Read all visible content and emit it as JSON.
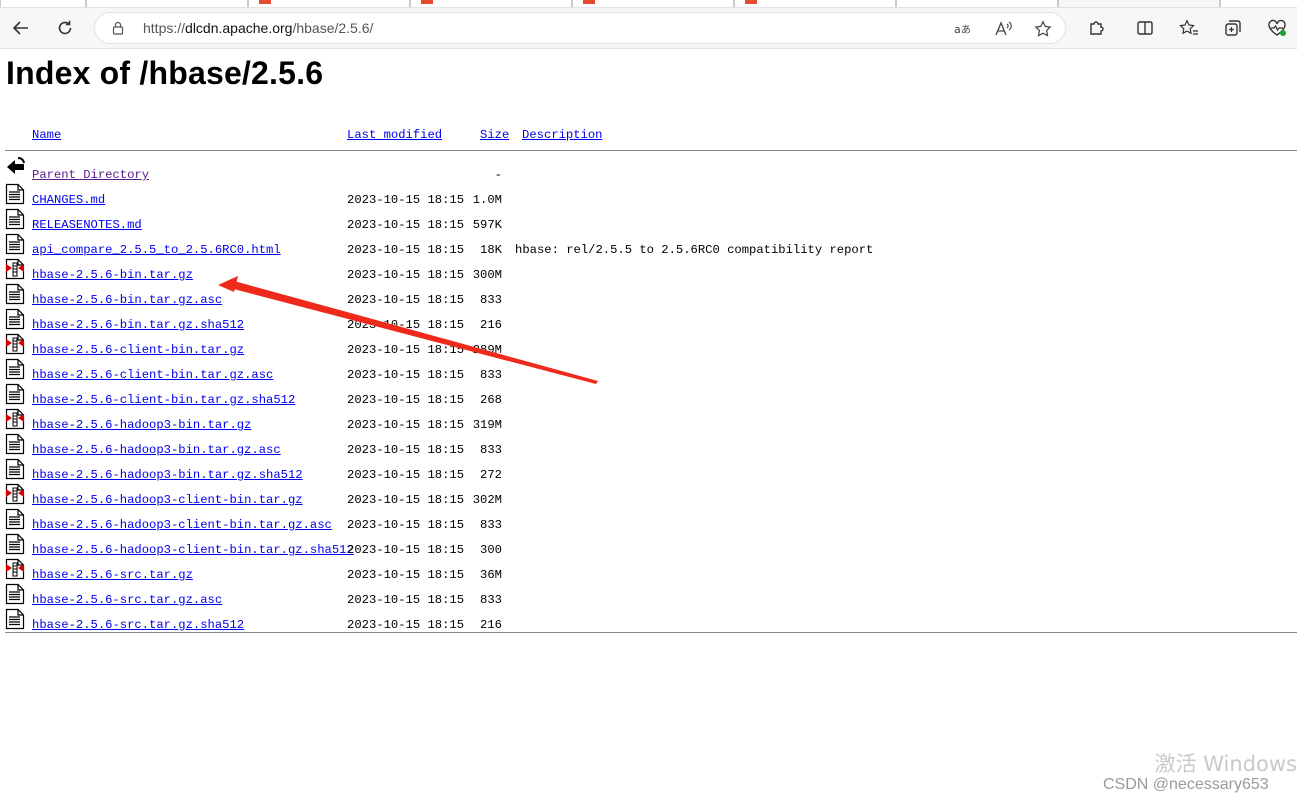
{
  "browser": {
    "url_prefix": "https://",
    "url_host": "dlcdn.apache.org",
    "url_path": "/hbase/2.5.6/"
  },
  "page": {
    "title": "Index of /hbase/2.5.6"
  },
  "listing": {
    "headers": {
      "name": "Name",
      "modified": "Last modified",
      "size": "Size",
      "description": "Description"
    },
    "rows": [
      {
        "name": "Parent Directory",
        "modified": "",
        "size": "-",
        "description": "",
        "icon": "back-icon",
        "visited": true
      },
      {
        "name": "CHANGES.md",
        "modified": "2023-10-15 18:15",
        "size": "1.0M",
        "description": "",
        "icon": "text-file-icon"
      },
      {
        "name": "RELEASENOTES.md",
        "modified": "2023-10-15 18:15",
        "size": "597K",
        "description": "",
        "icon": "text-file-icon"
      },
      {
        "name": "api_compare_2.5.5_to_2.5.6RC0.html",
        "modified": "2023-10-15 18:15",
        "size": "18K",
        "description": "hbase: rel/2.5.5 to 2.5.6RC0 compatibility report",
        "icon": "text-file-icon"
      },
      {
        "name": "hbase-2.5.6-bin.tar.gz",
        "modified": "2023-10-15 18:15",
        "size": "300M",
        "description": "",
        "icon": "archive-icon"
      },
      {
        "name": "hbase-2.5.6-bin.tar.gz.asc",
        "modified": "2023-10-15 18:15",
        "size": "833",
        "description": "",
        "icon": "text-file-icon"
      },
      {
        "name": "hbase-2.5.6-bin.tar.gz.sha512",
        "modified": "2023-10-15 18:15",
        "size": "216",
        "description": "",
        "icon": "text-file-icon"
      },
      {
        "name": "hbase-2.5.6-client-bin.tar.gz",
        "modified": "2023-10-15 18:15",
        "size": "289M",
        "description": "",
        "icon": "archive-icon"
      },
      {
        "name": "hbase-2.5.6-client-bin.tar.gz.asc",
        "modified": "2023-10-15 18:15",
        "size": "833",
        "description": "",
        "icon": "text-file-icon"
      },
      {
        "name": "hbase-2.5.6-client-bin.tar.gz.sha512",
        "modified": "2023-10-15 18:15",
        "size": "268",
        "description": "",
        "icon": "text-file-icon"
      },
      {
        "name": "hbase-2.5.6-hadoop3-bin.tar.gz",
        "modified": "2023-10-15 18:15",
        "size": "319M",
        "description": "",
        "icon": "archive-icon"
      },
      {
        "name": "hbase-2.5.6-hadoop3-bin.tar.gz.asc",
        "modified": "2023-10-15 18:15",
        "size": "833",
        "description": "",
        "icon": "text-file-icon"
      },
      {
        "name": "hbase-2.5.6-hadoop3-bin.tar.gz.sha512",
        "modified": "2023-10-15 18:15",
        "size": "272",
        "description": "",
        "icon": "text-file-icon"
      },
      {
        "name": "hbase-2.5.6-hadoop3-client-bin.tar.gz",
        "modified": "2023-10-15 18:15",
        "size": "302M",
        "description": "",
        "icon": "archive-icon"
      },
      {
        "name": "hbase-2.5.6-hadoop3-client-bin.tar.gz.asc",
        "modified": "2023-10-15 18:15",
        "size": "833",
        "description": "",
        "icon": "text-file-icon"
      },
      {
        "name": "hbase-2.5.6-hadoop3-client-bin.tar.gz.sha512",
        "modified": "2023-10-15 18:15",
        "size": "300",
        "description": "",
        "icon": "text-file-icon"
      },
      {
        "name": "hbase-2.5.6-src.tar.gz",
        "modified": "2023-10-15 18:15",
        "size": "36M",
        "description": "",
        "icon": "archive-icon"
      },
      {
        "name": "hbase-2.5.6-src.tar.gz.asc",
        "modified": "2023-10-15 18:15",
        "size": "833",
        "description": "",
        "icon": "text-file-icon"
      },
      {
        "name": "hbase-2.5.6-src.tar.gz.sha512",
        "modified": "2023-10-15 18:15",
        "size": "216",
        "description": "",
        "icon": "text-file-icon"
      }
    ]
  },
  "overlay": {
    "windows_activation": "激活 Windows",
    "csdn_watermark": "CSDN @necessary653",
    "arrow_color": "#ee2a1b"
  }
}
